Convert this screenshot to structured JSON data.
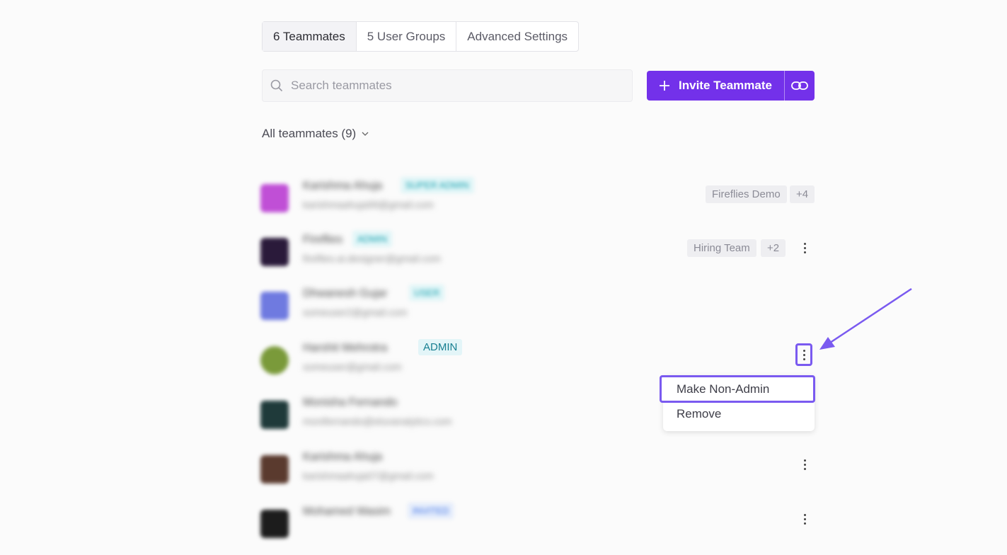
{
  "tabs": [
    {
      "label": "6 Teammates",
      "active": true
    },
    {
      "label": "5 User Groups",
      "active": false
    },
    {
      "label": "Advanced Settings",
      "active": false
    }
  ],
  "search": {
    "placeholder": "Search teammates"
  },
  "invite": {
    "label": "Invite Teammate"
  },
  "filter": {
    "label": "All teammates (9)"
  },
  "rows": [
    {
      "name": "Karishma Ahuja",
      "email": "karishmaahuja99@gmail.com",
      "role": "SUPER ADMIN",
      "groups": [
        "Fireflies Demo",
        "+4"
      ]
    },
    {
      "name": "Fireflies",
      "email": "fireflies.ai.designer@gmail.com",
      "role": "ADMIN",
      "groups": [
        "Hiring Team",
        "+2"
      ]
    },
    {
      "name": "Dhwanesh Gujar",
      "email": "someuser2@gmail.com",
      "role": "USER",
      "groups": []
    },
    {
      "name": "Harshit Mehrotra",
      "email": "someuser@gmail.com",
      "role": "ADMIN",
      "groups": []
    },
    {
      "name": "Monisha Fernando",
      "email": "monifernando@eluvanalytics.com",
      "role": "",
      "groups": []
    },
    {
      "name": "Karishma Ahuja",
      "email": "karishmaahuja07@gmail.com",
      "role": "",
      "groups": []
    },
    {
      "name": "Mohamed Wasim",
      "email": "",
      "role": "INVITED",
      "groups": []
    }
  ],
  "menu": {
    "items": [
      "Make Non-Admin",
      "Remove"
    ]
  },
  "colors": {
    "accent": "#7331ea",
    "highlight": "#7a5af0"
  }
}
